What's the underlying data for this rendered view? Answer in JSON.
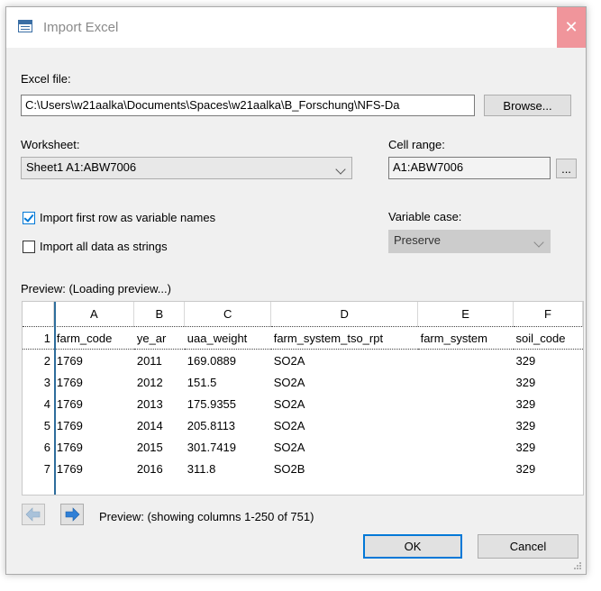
{
  "window": {
    "title": "Import Excel",
    "close_glyph": "✕"
  },
  "excel_file": {
    "label": "Excel file:",
    "value": "C:\\Users\\w21aalka\\Documents\\Spaces\\w21aalka\\B_Forschung\\NFS-Da",
    "browse_label": "Browse..."
  },
  "worksheet": {
    "label": "Worksheet:",
    "value": "Sheet1 A1:ABW7006"
  },
  "cell_range": {
    "label": "Cell range:",
    "value": "A1:ABW7006",
    "more_label": "..."
  },
  "options": {
    "first_row_label": "Import first row as variable names",
    "first_row_checked": true,
    "strings_label": "Import all data as strings",
    "strings_checked": false
  },
  "variable_case": {
    "label": "Variable case:",
    "value": "Preserve"
  },
  "preview": {
    "label": "Preview: (Loading preview...)",
    "columns": [
      "A",
      "B",
      "C",
      "D",
      "E",
      "F"
    ],
    "rows": [
      [
        "1",
        "farm_code",
        "ye_ar",
        "uaa_weight",
        "farm_system_tso_rpt",
        "farm_system",
        "soil_code"
      ],
      [
        "2",
        "1769",
        "2011",
        "169.0889",
        "SO2A",
        "",
        "329"
      ],
      [
        "3",
        "1769",
        "2012",
        "151.5",
        "SO2A",
        "",
        "329"
      ],
      [
        "4",
        "1769",
        "2013",
        "175.9355",
        "SO2A",
        "",
        "329"
      ],
      [
        "5",
        "1769",
        "2014",
        "205.8113",
        "SO2A",
        "",
        "329"
      ],
      [
        "6",
        "1769",
        "2015",
        "301.7419",
        "SO2A",
        "",
        "329"
      ],
      [
        "7",
        "1769",
        "2016",
        "311.8",
        "SO2B",
        "",
        "329"
      ]
    ],
    "status": "Preview: (showing columns 1-250 of 751)"
  },
  "buttons": {
    "ok": "OK",
    "cancel": "Cancel"
  },
  "colors": {
    "accent": "#0078d7",
    "close_hover": "#f0959b",
    "nav_arrow": "#2f7fd6",
    "nav_arrow_disabled": "#a9c2da"
  },
  "icons": {
    "app": "spreadsheet-icon",
    "prev": "arrow-left-icon",
    "next": "arrow-right-icon",
    "close": "close-icon"
  }
}
